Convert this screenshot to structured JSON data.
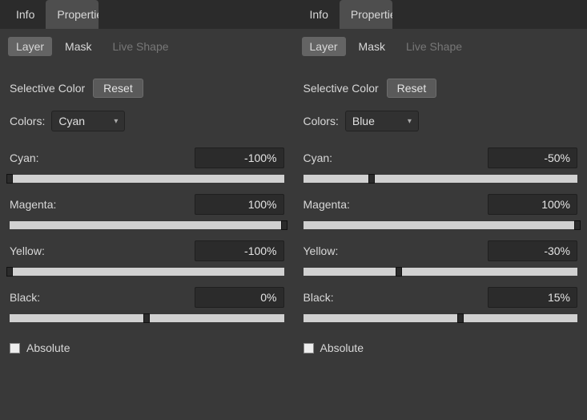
{
  "panels": [
    {
      "topTabs": {
        "info": "Info",
        "properties": "Properties"
      },
      "subTabs": {
        "layer": "Layer",
        "mask": "Mask",
        "liveShape": "Live Shape"
      },
      "section": {
        "title": "Selective Color",
        "reset": "Reset"
      },
      "colorsLabel": "Colors:",
      "colorsValue": "Cyan",
      "sliders": [
        {
          "label": "Cyan:",
          "value": "-100%",
          "pos": 0
        },
        {
          "label": "Magenta:",
          "value": "100%",
          "pos": 100
        },
        {
          "label": "Yellow:",
          "value": "-100%",
          "pos": 0
        },
        {
          "label": "Black:",
          "value": "0%",
          "pos": 50
        }
      ],
      "absolute": "Absolute"
    },
    {
      "topTabs": {
        "info": "Info",
        "properties": "Properties"
      },
      "subTabs": {
        "layer": "Layer",
        "mask": "Mask",
        "liveShape": "Live Shape"
      },
      "section": {
        "title": "Selective Color",
        "reset": "Reset"
      },
      "colorsLabel": "Colors:",
      "colorsValue": "Blue",
      "sliders": [
        {
          "label": "Cyan:",
          "value": "-50%",
          "pos": 25
        },
        {
          "label": "Magenta:",
          "value": "100%",
          "pos": 100
        },
        {
          "label": "Yellow:",
          "value": "-30%",
          "pos": 35
        },
        {
          "label": "Black:",
          "value": "15%",
          "pos": 57.5
        }
      ],
      "absolute": "Absolute"
    }
  ]
}
